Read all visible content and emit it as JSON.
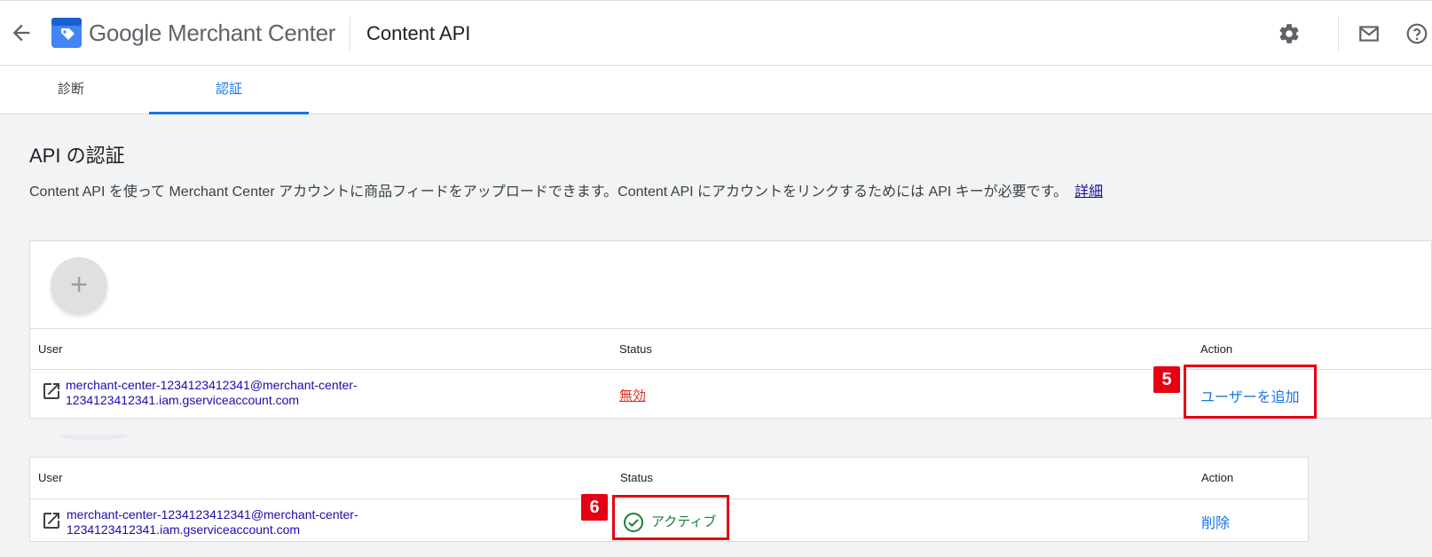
{
  "header": {
    "brand_google": "Google",
    "brand_product": "Merchant Center",
    "page_product": "Content API",
    "icons": [
      "back-arrow-icon",
      "merchant-center-logo",
      "gear-icon",
      "mail-icon",
      "help-icon"
    ]
  },
  "tabs": [
    {
      "label": "診断",
      "active": false
    },
    {
      "label": "認証",
      "active": true
    }
  ],
  "main": {
    "title": "API の認証",
    "description": "Content API を使って Merchant Center アカウントに商品フィードをアップロードできます。Content API にアカウントをリンクするためには API キーが必要です。",
    "details_link": "詳細"
  },
  "table1": {
    "add_label": "+",
    "columns": {
      "user": "User",
      "status": "Status",
      "action": "Action"
    },
    "row": {
      "user_line1": "merchant-center-1234123412341@merchant-center-",
      "user_line2": "1234123412341.iam.gserviceaccount.com",
      "status": "無効",
      "action": "ユーザーを追加"
    }
  },
  "table2": {
    "columns": {
      "user": "User",
      "status": "Status",
      "action": "Action"
    },
    "row": {
      "user_line1": "merchant-center-1234123412341@merchant-center-",
      "user_line2": "1234123412341.iam.gserviceaccount.com",
      "status": "アクティブ",
      "action": "削除"
    }
  },
  "annotations": {
    "badge5": "5",
    "badge6": "6",
    "callout_color": "#e60012"
  }
}
